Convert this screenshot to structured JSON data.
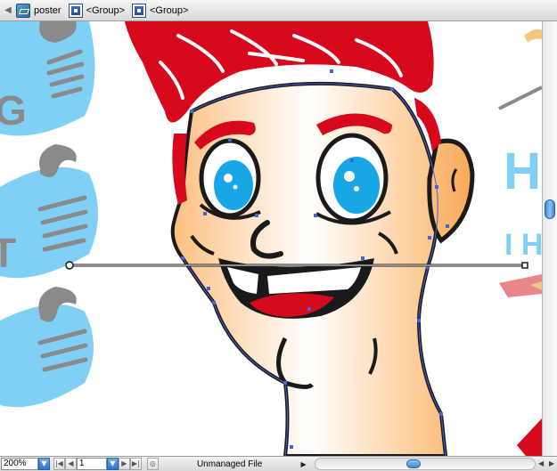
{
  "breadcrumb": {
    "items": [
      {
        "label": "poster",
        "icon": "layer-icon"
      },
      {
        "label": "<Group>",
        "icon": "group-icon"
      },
      {
        "label": "<Group>",
        "icon": "group-icon"
      }
    ]
  },
  "artwork": {
    "right_text_1": "HI",
    "right_text_2": "I HA",
    "left_text_1": "G",
    "left_text_2": "T",
    "colors": {
      "hair": "#d7081c",
      "skin_light": "#ffffff",
      "skin_dark": "#fcbf7e",
      "eye": "#18a6e6",
      "banner": "#7fd0f4",
      "mouth": "#d40b1c",
      "outline": "#1a1a1a",
      "selection": "#4a62d8"
    }
  },
  "statusbar": {
    "zoom": "200%",
    "page": "1",
    "status_text": "Unmanaged File"
  }
}
